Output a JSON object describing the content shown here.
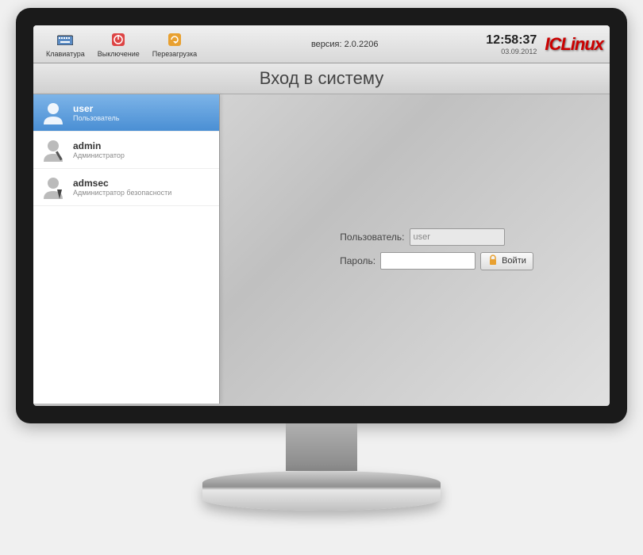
{
  "toolbar": {
    "keyboard": "Клавиатура",
    "shutdown": "Выключение",
    "reboot": "Перезагрузка",
    "version_label": "версия: 2.0.2206",
    "time": "12:58:37",
    "date": "03.09.2012",
    "brand": "ICLinux"
  },
  "title": "Вход в систему",
  "users": [
    {
      "name": "user",
      "role": "Пользователь",
      "selected": true
    },
    {
      "name": "admin",
      "role": "Администратор",
      "selected": false
    },
    {
      "name": "admsec",
      "role": "Администратор безопасности",
      "selected": false
    }
  ],
  "form": {
    "user_label": "Пользователь:",
    "user_value": "user",
    "password_label": "Пароль:",
    "password_value": "",
    "login_button": "Войти"
  }
}
